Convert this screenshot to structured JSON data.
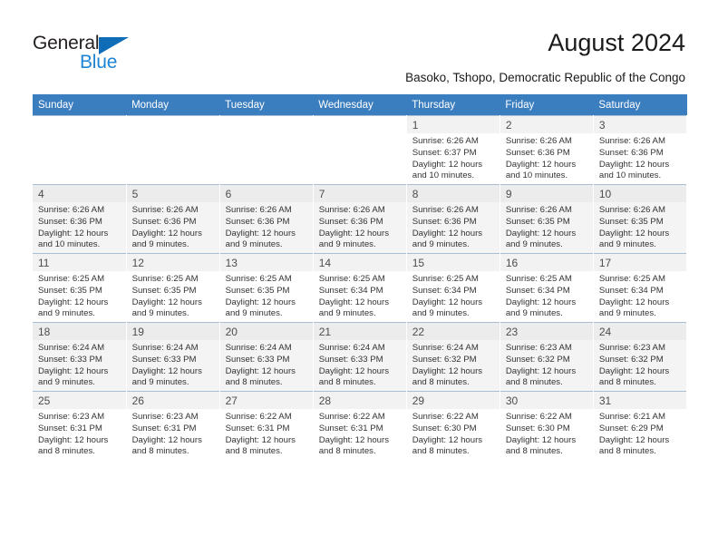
{
  "brand": {
    "name_dark": "General",
    "name_light": "Blue",
    "color_dark": "#231f20",
    "color_light": "#1e84d4",
    "triangle_color": "#0f6cb6"
  },
  "header": {
    "title": "August 2024",
    "subtitle": "Basoko, Tshopo, Democratic Republic of the Congo"
  },
  "theme": {
    "header_row_bg": "#3b7ec0",
    "header_row_text": "#ffffff",
    "row_shade_bg": "#f4f4f4",
    "daynum_bg": "#f2f2f2",
    "grid_line": "#a9bdd4"
  },
  "weekdays": [
    "Sunday",
    "Monday",
    "Tuesday",
    "Wednesday",
    "Thursday",
    "Friday",
    "Saturday"
  ],
  "weeks": [
    [
      {
        "day": "",
        "sunrise": "",
        "sunset": "",
        "daylight1": "",
        "daylight2": ""
      },
      {
        "day": "",
        "sunrise": "",
        "sunset": "",
        "daylight1": "",
        "daylight2": ""
      },
      {
        "day": "",
        "sunrise": "",
        "sunset": "",
        "daylight1": "",
        "daylight2": ""
      },
      {
        "day": "",
        "sunrise": "",
        "sunset": "",
        "daylight1": "",
        "daylight2": ""
      },
      {
        "day": "1",
        "sunrise": "Sunrise: 6:26 AM",
        "sunset": "Sunset: 6:37 PM",
        "daylight1": "Daylight: 12 hours",
        "daylight2": "and 10 minutes."
      },
      {
        "day": "2",
        "sunrise": "Sunrise: 6:26 AM",
        "sunset": "Sunset: 6:36 PM",
        "daylight1": "Daylight: 12 hours",
        "daylight2": "and 10 minutes."
      },
      {
        "day": "3",
        "sunrise": "Sunrise: 6:26 AM",
        "sunset": "Sunset: 6:36 PM",
        "daylight1": "Daylight: 12 hours",
        "daylight2": "and 10 minutes."
      }
    ],
    [
      {
        "day": "4",
        "sunrise": "Sunrise: 6:26 AM",
        "sunset": "Sunset: 6:36 PM",
        "daylight1": "Daylight: 12 hours",
        "daylight2": "and 10 minutes."
      },
      {
        "day": "5",
        "sunrise": "Sunrise: 6:26 AM",
        "sunset": "Sunset: 6:36 PM",
        "daylight1": "Daylight: 12 hours",
        "daylight2": "and 9 minutes."
      },
      {
        "day": "6",
        "sunrise": "Sunrise: 6:26 AM",
        "sunset": "Sunset: 6:36 PM",
        "daylight1": "Daylight: 12 hours",
        "daylight2": "and 9 minutes."
      },
      {
        "day": "7",
        "sunrise": "Sunrise: 6:26 AM",
        "sunset": "Sunset: 6:36 PM",
        "daylight1": "Daylight: 12 hours",
        "daylight2": "and 9 minutes."
      },
      {
        "day": "8",
        "sunrise": "Sunrise: 6:26 AM",
        "sunset": "Sunset: 6:36 PM",
        "daylight1": "Daylight: 12 hours",
        "daylight2": "and 9 minutes."
      },
      {
        "day": "9",
        "sunrise": "Sunrise: 6:26 AM",
        "sunset": "Sunset: 6:35 PM",
        "daylight1": "Daylight: 12 hours",
        "daylight2": "and 9 minutes."
      },
      {
        "day": "10",
        "sunrise": "Sunrise: 6:26 AM",
        "sunset": "Sunset: 6:35 PM",
        "daylight1": "Daylight: 12 hours",
        "daylight2": "and 9 minutes."
      }
    ],
    [
      {
        "day": "11",
        "sunrise": "Sunrise: 6:25 AM",
        "sunset": "Sunset: 6:35 PM",
        "daylight1": "Daylight: 12 hours",
        "daylight2": "and 9 minutes."
      },
      {
        "day": "12",
        "sunrise": "Sunrise: 6:25 AM",
        "sunset": "Sunset: 6:35 PM",
        "daylight1": "Daylight: 12 hours",
        "daylight2": "and 9 minutes."
      },
      {
        "day": "13",
        "sunrise": "Sunrise: 6:25 AM",
        "sunset": "Sunset: 6:35 PM",
        "daylight1": "Daylight: 12 hours",
        "daylight2": "and 9 minutes."
      },
      {
        "day": "14",
        "sunrise": "Sunrise: 6:25 AM",
        "sunset": "Sunset: 6:34 PM",
        "daylight1": "Daylight: 12 hours",
        "daylight2": "and 9 minutes."
      },
      {
        "day": "15",
        "sunrise": "Sunrise: 6:25 AM",
        "sunset": "Sunset: 6:34 PM",
        "daylight1": "Daylight: 12 hours",
        "daylight2": "and 9 minutes."
      },
      {
        "day": "16",
        "sunrise": "Sunrise: 6:25 AM",
        "sunset": "Sunset: 6:34 PM",
        "daylight1": "Daylight: 12 hours",
        "daylight2": "and 9 minutes."
      },
      {
        "day": "17",
        "sunrise": "Sunrise: 6:25 AM",
        "sunset": "Sunset: 6:34 PM",
        "daylight1": "Daylight: 12 hours",
        "daylight2": "and 9 minutes."
      }
    ],
    [
      {
        "day": "18",
        "sunrise": "Sunrise: 6:24 AM",
        "sunset": "Sunset: 6:33 PM",
        "daylight1": "Daylight: 12 hours",
        "daylight2": "and 9 minutes."
      },
      {
        "day": "19",
        "sunrise": "Sunrise: 6:24 AM",
        "sunset": "Sunset: 6:33 PM",
        "daylight1": "Daylight: 12 hours",
        "daylight2": "and 9 minutes."
      },
      {
        "day": "20",
        "sunrise": "Sunrise: 6:24 AM",
        "sunset": "Sunset: 6:33 PM",
        "daylight1": "Daylight: 12 hours",
        "daylight2": "and 8 minutes."
      },
      {
        "day": "21",
        "sunrise": "Sunrise: 6:24 AM",
        "sunset": "Sunset: 6:33 PM",
        "daylight1": "Daylight: 12 hours",
        "daylight2": "and 8 minutes."
      },
      {
        "day": "22",
        "sunrise": "Sunrise: 6:24 AM",
        "sunset": "Sunset: 6:32 PM",
        "daylight1": "Daylight: 12 hours",
        "daylight2": "and 8 minutes."
      },
      {
        "day": "23",
        "sunrise": "Sunrise: 6:23 AM",
        "sunset": "Sunset: 6:32 PM",
        "daylight1": "Daylight: 12 hours",
        "daylight2": "and 8 minutes."
      },
      {
        "day": "24",
        "sunrise": "Sunrise: 6:23 AM",
        "sunset": "Sunset: 6:32 PM",
        "daylight1": "Daylight: 12 hours",
        "daylight2": "and 8 minutes."
      }
    ],
    [
      {
        "day": "25",
        "sunrise": "Sunrise: 6:23 AM",
        "sunset": "Sunset: 6:31 PM",
        "daylight1": "Daylight: 12 hours",
        "daylight2": "and 8 minutes."
      },
      {
        "day": "26",
        "sunrise": "Sunrise: 6:23 AM",
        "sunset": "Sunset: 6:31 PM",
        "daylight1": "Daylight: 12 hours",
        "daylight2": "and 8 minutes."
      },
      {
        "day": "27",
        "sunrise": "Sunrise: 6:22 AM",
        "sunset": "Sunset: 6:31 PM",
        "daylight1": "Daylight: 12 hours",
        "daylight2": "and 8 minutes."
      },
      {
        "day": "28",
        "sunrise": "Sunrise: 6:22 AM",
        "sunset": "Sunset: 6:31 PM",
        "daylight1": "Daylight: 12 hours",
        "daylight2": "and 8 minutes."
      },
      {
        "day": "29",
        "sunrise": "Sunrise: 6:22 AM",
        "sunset": "Sunset: 6:30 PM",
        "daylight1": "Daylight: 12 hours",
        "daylight2": "and 8 minutes."
      },
      {
        "day": "30",
        "sunrise": "Sunrise: 6:22 AM",
        "sunset": "Sunset: 6:30 PM",
        "daylight1": "Daylight: 12 hours",
        "daylight2": "and 8 minutes."
      },
      {
        "day": "31",
        "sunrise": "Sunrise: 6:21 AM",
        "sunset": "Sunset: 6:29 PM",
        "daylight1": "Daylight: 12 hours",
        "daylight2": "and 8 minutes."
      }
    ]
  ]
}
